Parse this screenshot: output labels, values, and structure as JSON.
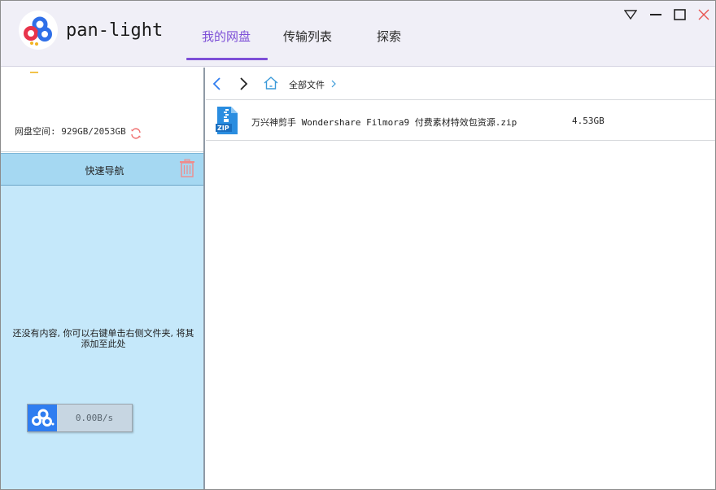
{
  "app": {
    "title": "pan-light"
  },
  "tabs": [
    {
      "label": "我的网盘",
      "active": true
    },
    {
      "label": "传输列表",
      "active": false
    },
    {
      "label": "探索",
      "active": false
    }
  ],
  "window_controls": [
    "dropdown-icon",
    "minimize-icon",
    "maximize-icon",
    "close-icon"
  ],
  "sidebar": {
    "quota_text": "网盘空间: 929GB/2053GB",
    "quick_nav_label": "快速导航",
    "empty_tip": "还没有内容, 你可以右键单击右侧文件夹, 将其添加至此处",
    "speed": "0.00B/s"
  },
  "pathbar": {
    "breadcrumb": "全部文件"
  },
  "files": [
    {
      "name": "万兴神剪手 Wondershare Filmora9 付费素材特效包资源.zip",
      "size": "4.53GB",
      "icon": "zip-file-icon"
    }
  ],
  "colors": {
    "accent": "#7d4fd7",
    "nav_header": "#a5d8f2",
    "nav_body": "#c5e8fa",
    "speed_icon": "#2f7df0"
  }
}
